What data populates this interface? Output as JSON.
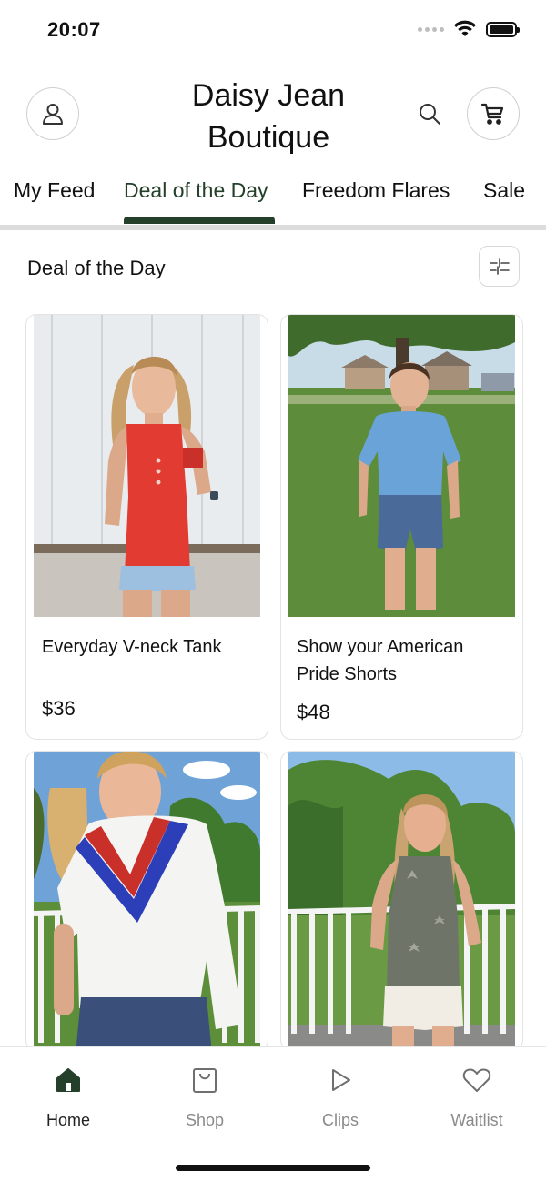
{
  "status_bar": {
    "time": "20:07"
  },
  "header": {
    "brand": "Daisy Jean Boutique"
  },
  "tabs": [
    {
      "label": "My Feed"
    },
    {
      "label": "Deal of the Day"
    },
    {
      "label": "Freedom Flares"
    },
    {
      "label": "Sale"
    }
  ],
  "active_tab": "Deal of the Day",
  "section": {
    "title": "Deal of the Day"
  },
  "products": [
    {
      "name": "Everyday V-neck Tank",
      "price": "$36"
    },
    {
      "name": "Show your American Pride Shorts",
      "price": "$48"
    },
    {
      "name": "",
      "price": ""
    },
    {
      "name": "",
      "price": ""
    }
  ],
  "bottom_nav": [
    {
      "label": "Home",
      "icon": "home-icon"
    },
    {
      "label": "Shop",
      "icon": "shopping-bag-icon"
    },
    {
      "label": "Clips",
      "icon": "play-icon"
    },
    {
      "label": "Waitlist",
      "icon": "heart-icon"
    }
  ],
  "colors": {
    "accent": "#24402a",
    "inactive": "#8a8a8a",
    "divider": "#dcdcdc"
  }
}
